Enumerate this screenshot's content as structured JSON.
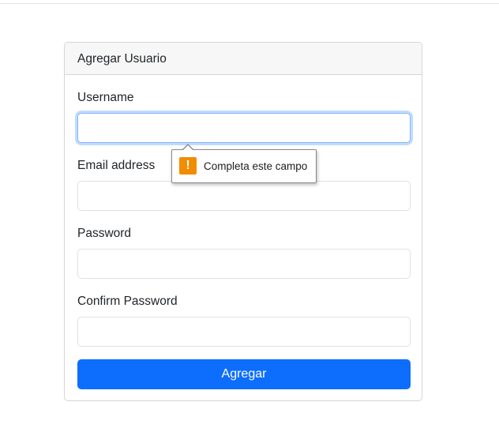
{
  "card": {
    "title": "Agregar Usuario"
  },
  "fields": [
    {
      "label": "Username",
      "value": "",
      "placeholder": ""
    },
    {
      "label": "Email address",
      "value": "",
      "placeholder": ""
    },
    {
      "label": "Password",
      "value": "",
      "placeholder": ""
    },
    {
      "label": "Confirm Password",
      "value": "",
      "placeholder": ""
    }
  ],
  "submit": {
    "label": "Agregar",
    "color": "#0d6efd"
  },
  "validation_tooltip": {
    "message": "Completa este campo",
    "icon": "warning-icon",
    "icon_glyph": "!",
    "icon_color": "#f28c00"
  }
}
